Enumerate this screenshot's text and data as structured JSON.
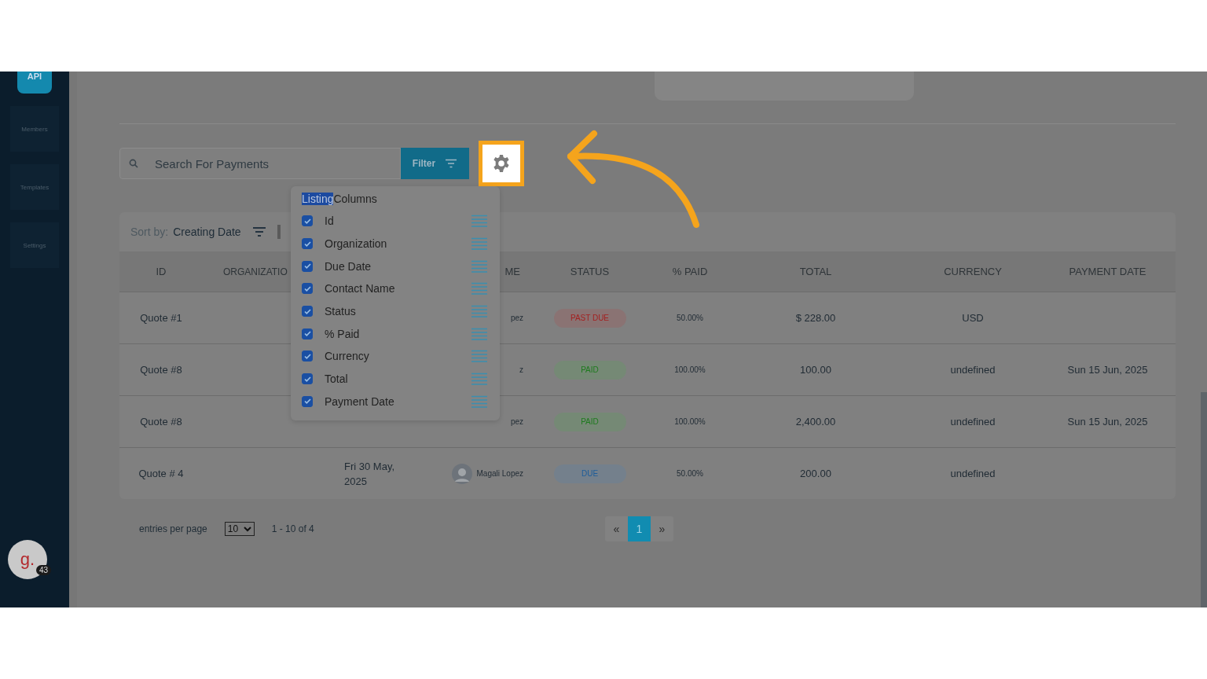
{
  "sidebar": {
    "logo": "API",
    "items": [
      {
        "label": "Members"
      },
      {
        "label": "Templates"
      },
      {
        "label": "Settings"
      }
    ],
    "avatar": {
      "letter": "g.",
      "badge": "43"
    }
  },
  "toolbar": {
    "search": {
      "placeholder": "Search For Payments"
    },
    "filter_button": "Filter",
    "settings_highlighted": true
  },
  "sort": {
    "label": "Sort by:",
    "value": "Creating Date"
  },
  "table": {
    "columns": [
      "ID",
      "ORGANIZATIO",
      "ME",
      "STATUS",
      "% PAID",
      "TOTAL",
      "CURRENCY",
      "PAYMENT DATE"
    ],
    "rows": [
      {
        "id": "Quote #1",
        "contact": "pez",
        "avatar": false,
        "status": "PAST DUE",
        "kind": "past_due",
        "paid": "50.00%",
        "total": "$ 228.00",
        "currency": "USD"
      },
      {
        "id": "Quote #8",
        "contact": "z",
        "avatar": false,
        "status": "PAID",
        "kind": "paid",
        "paid": "100.00%",
        "total": "100.00",
        "currency": "undefined",
        "payment_date": "Sun 15 Jun, 2025"
      },
      {
        "id": "Quote #8",
        "contact": "pez",
        "avatar": false,
        "status": "PAID",
        "kind": "paid",
        "paid": "100.00%",
        "total": "2,400.00",
        "currency": "undefined",
        "payment_date": "Sun 15 Jun, 2025"
      },
      {
        "id": "Quote # 4",
        "due_date": "Fri 30 May, 2025",
        "contact": "Magali Lopez",
        "avatar": true,
        "status": "DUE",
        "kind": "due",
        "paid": "50.00%",
        "total": "200.00",
        "currency": "undefined"
      }
    ]
  },
  "columns_menu": {
    "title_highlighted": "Listing",
    "title_rest": "Columns",
    "items": [
      {
        "label": "Id",
        "checked": true
      },
      {
        "label": "Organization",
        "checked": true
      },
      {
        "label": "Due Date",
        "checked": true
      },
      {
        "label": "Contact Name",
        "checked": true
      },
      {
        "label": "Status",
        "checked": true
      },
      {
        "label": "% Paid",
        "checked": true
      },
      {
        "label": "Currency",
        "checked": true
      },
      {
        "label": "Total",
        "checked": true
      },
      {
        "label": "Payment Date",
        "checked": true
      }
    ]
  },
  "footer": {
    "entries_label": "entries per page",
    "per_page": "10",
    "range": "1 - 10 of 4",
    "pages": [
      {
        "label": "«",
        "selected": false
      },
      {
        "label": "1",
        "selected": true
      },
      {
        "label": "»",
        "selected": false
      }
    ]
  }
}
